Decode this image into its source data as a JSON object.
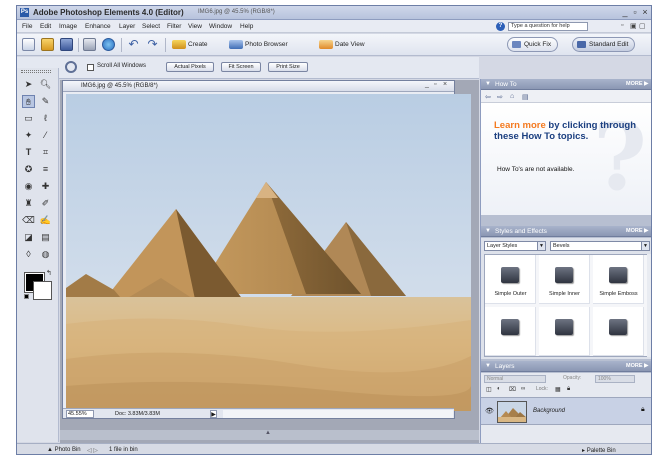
{
  "window": {
    "app_title": "Adobe Photoshop Elements 4.0 (Editor)",
    "doc_title": "IMG6.jpg @ 45.5% (RGB/8*)",
    "controls": [
      "_",
      "▫",
      "×"
    ]
  },
  "menu": {
    "items": [
      "File",
      "Edit",
      "Image",
      "Enhance",
      "Layer",
      "Select",
      "Filter",
      "View",
      "Window",
      "Help"
    ],
    "help_placeholder": "Type a question for help",
    "mini_controls": [
      "▫",
      "▣",
      "▢"
    ]
  },
  "shortcuts": {
    "create_label": "Create",
    "photo_browser_label": "Photo Browser",
    "date_view_label": "Date View",
    "quick_fix_label": "Quick Fix",
    "standard_edit_label": "Standard Edit"
  },
  "options": {
    "scroll_all_windows_label": "Scroll All Windows",
    "actual_pixels_label": "Actual Pixels",
    "fit_screen_label": "Fit Screen",
    "print_size_label": "Print Size"
  },
  "document": {
    "title": "IMG6.jpg @ 45.5% (RGB/8*)",
    "zoom": "45.55%",
    "info": "Doc: 3.83M/3.83M",
    "nav_arrow": "▶"
  },
  "palettes": {
    "more_label": "MORE",
    "how_to": {
      "title": "How To",
      "highlight": "Learn more",
      "text": " by clicking through these How To topics.",
      "note": "How To's are not available."
    },
    "styles": {
      "title": "Styles and Effects",
      "category": "Layer Styles",
      "library": "Bevels",
      "items": [
        "Simple Outer",
        "Simple Inner",
        "Simple Emboss",
        "",
        "",
        ""
      ]
    },
    "layers": {
      "title": "Layers",
      "blend_mode": "Normal",
      "opacity_label": "Opacity:",
      "opacity_value": "100%",
      "lock_label": "Lock:",
      "layer_name": "Background"
    }
  },
  "statusbar": {
    "photo_bin_label": "Photo Bin",
    "file_count_label": "1 file in bin",
    "palette_bin_label": "Palette Bin"
  },
  "colors": {
    "accent": "#f47a20",
    "link_blue": "#1b3f80",
    "title_bar": "#b7c3dd",
    "sky": "#c5d5e6",
    "sand": "#d7b98a"
  }
}
